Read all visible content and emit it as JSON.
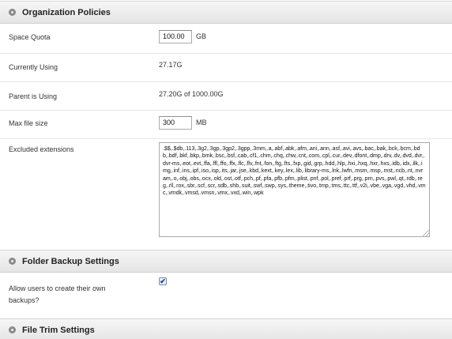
{
  "org_policies": {
    "title": "Organization Policies",
    "space_quota": {
      "label": "Space Quota",
      "value": "100.00",
      "unit": "GB"
    },
    "currently_using": {
      "label": "Currently Using",
      "value": "27.17G"
    },
    "parent_using": {
      "label": "Parent is Using",
      "value": "27.20G of 1000.00G"
    },
    "max_file_size": {
      "label": "Max file size",
      "value": "300",
      "unit": "MB"
    },
    "excluded_extensions": {
      "label": "Excluded extensions",
      "value": ".$$,.$db,.113,.3g2,.3gp,.3gp2,.3gpp,.3mm,.a,.abf,.abk,.afm,.ani,.ann,.asf,.avi,.avs,.bac,.bak,.bck,.bcm,.bdb,.bdf,.bkf,.bkp,.bmk,.bsc,.bsf,.cab,.cf1,.chm,.chq,.chw,.cnt,.com,.cpl,.cur,.dev,.dfont,.dmp,.drv,.dv,.dvd,.dvr,.dvr-ms,.eot,.evt,.ffa,.ffl,.ffo,.ffx,.flc,.flv,.fnt,.fon,.ftg,.fts,.fxp,.gid,.grp,.hdd,.hlp,.hxi,.hxq,.hxr,.hxs,.idb,.idx,.ilk,.img,.inf,.ins,.ipf,.iso,.isp,.its,.jar,.jse,.kbd,.kext,.key,.lex,.lib,.library-ms,.lnk,.lwfn,.msm,.msp,.mst,.ncb,.nt,.nvram,.o,.obj,.obs,.ocx,.old,.ost,.otf,.pch,.pf,.pfa,.pfb,.pfm,.plist,.pnf,.pol,.pref,.prf,.prg,.prn,.pvs,.pwl,.qt,.rdb,.reg,.rll,.rox,.sbr,.scf,.scr,.sdb,.shb,.suit,.swf,.swp,.sys,.theme,.tivo,.tmp,.tms,.ttc,.ttf,.v2i,.vbe,.vga,.vgd,.vhd,.vmc,.vmdk,.vmsd,.vmsn,.vmx,.vxd,.win,.wpk"
    }
  },
  "folder_backup": {
    "title": "Folder Backup Settings",
    "allow_label": "Allow users to create their own backups?",
    "checked_glyph": "✔"
  },
  "file_trim": {
    "title": "File Trim Settings"
  },
  "icons": {
    "section_icon": "gear-icon"
  }
}
